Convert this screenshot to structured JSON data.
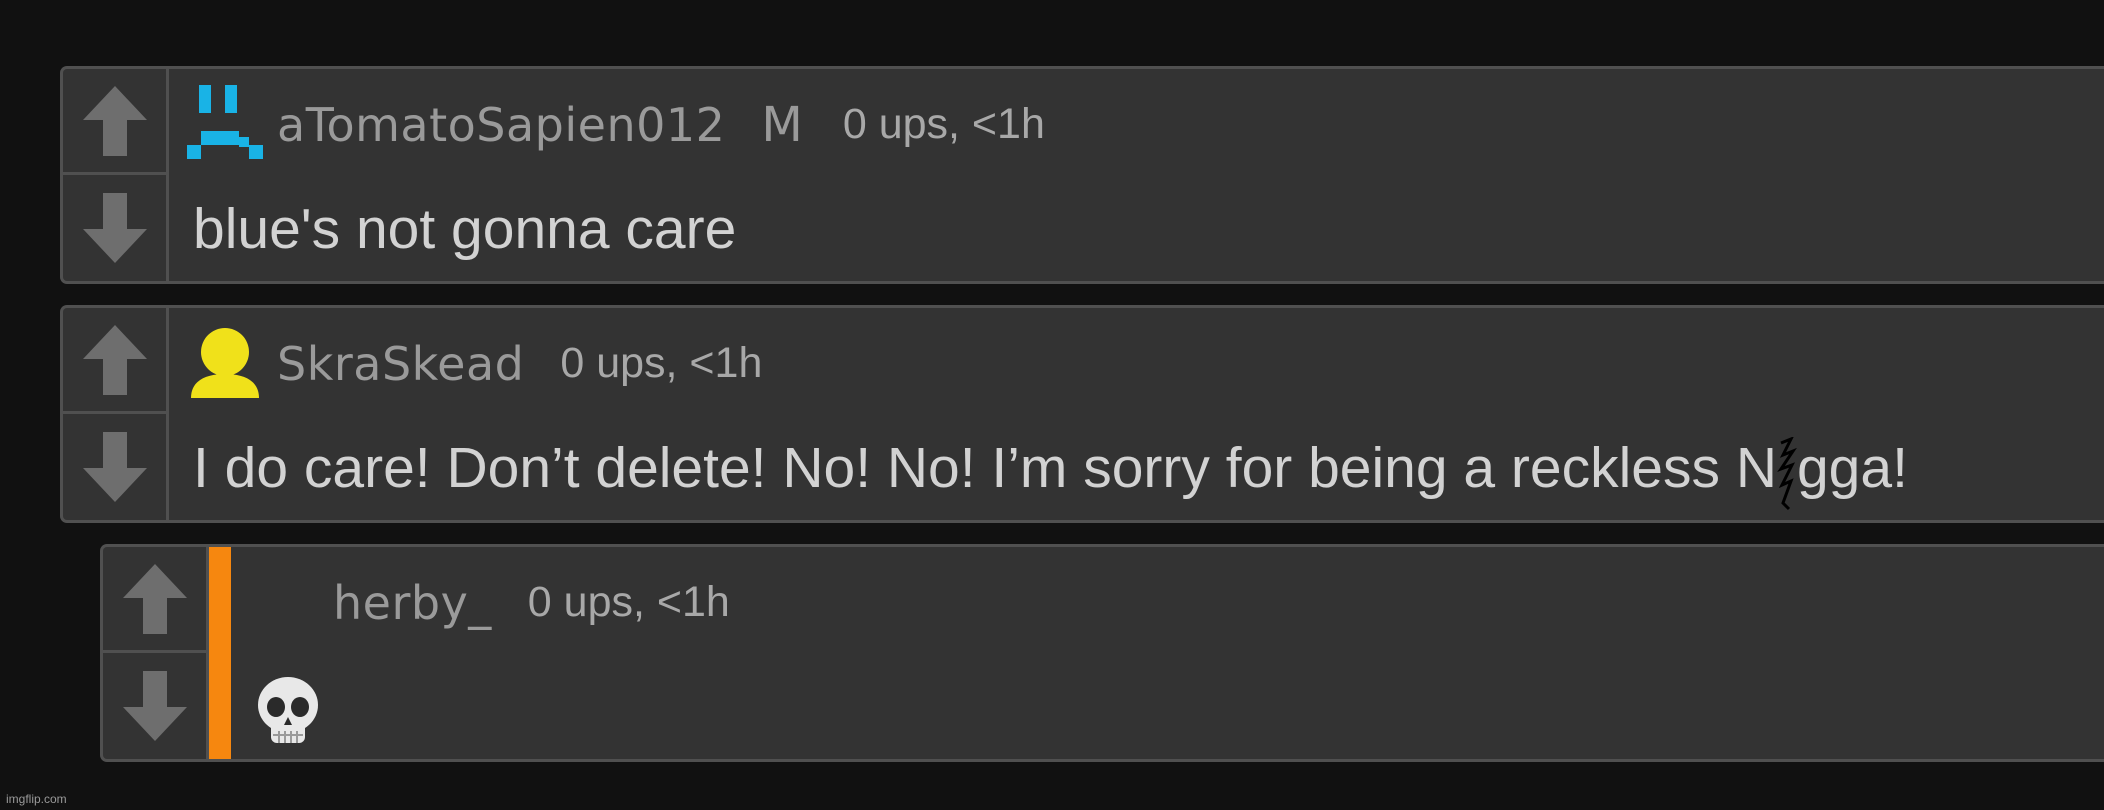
{
  "comments": [
    {
      "username": "aTomatoSapien012",
      "badge": "M",
      "meta": "0 ups, <1h",
      "text": "blue's not gonna care",
      "avatar_icon": "blue-frown-pixel-icon",
      "avatar_color": "#19b3e6"
    },
    {
      "username": "SkraSkead",
      "meta": "0 ups, <1h",
      "text_before": "I do care! Don’t delete! No! No! I’m sorry for being a reckless N",
      "text_after": "gga!",
      "avatar_icon": "yellow-person-icon",
      "avatar_color": "#f0e11a"
    },
    {
      "username": "herby_",
      "meta": "0 ups, <1h",
      "body_icon": "skull-emoji-icon",
      "reply_accent": "#f6870f"
    }
  ],
  "watermark": "imgflip.com",
  "colors": {
    "background": "#111111",
    "card": "#333333",
    "border": "#505050",
    "arrow": "#6e6e6e"
  }
}
